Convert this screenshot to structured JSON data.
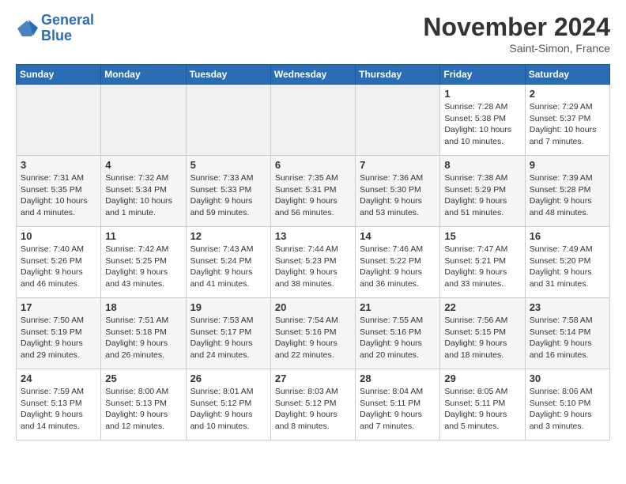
{
  "header": {
    "logo_line1": "General",
    "logo_line2": "Blue",
    "month_title": "November 2024",
    "location": "Saint-Simon, France"
  },
  "weekdays": [
    "Sunday",
    "Monday",
    "Tuesday",
    "Wednesday",
    "Thursday",
    "Friday",
    "Saturday"
  ],
  "weeks": [
    [
      {
        "day": "",
        "info": ""
      },
      {
        "day": "",
        "info": ""
      },
      {
        "day": "",
        "info": ""
      },
      {
        "day": "",
        "info": ""
      },
      {
        "day": "",
        "info": ""
      },
      {
        "day": "1",
        "info": "Sunrise: 7:28 AM\nSunset: 5:38 PM\nDaylight: 10 hours and 10 minutes."
      },
      {
        "day": "2",
        "info": "Sunrise: 7:29 AM\nSunset: 5:37 PM\nDaylight: 10 hours and 7 minutes."
      }
    ],
    [
      {
        "day": "3",
        "info": "Sunrise: 7:31 AM\nSunset: 5:35 PM\nDaylight: 10 hours and 4 minutes."
      },
      {
        "day": "4",
        "info": "Sunrise: 7:32 AM\nSunset: 5:34 PM\nDaylight: 10 hours and 1 minute."
      },
      {
        "day": "5",
        "info": "Sunrise: 7:33 AM\nSunset: 5:33 PM\nDaylight: 9 hours and 59 minutes."
      },
      {
        "day": "6",
        "info": "Sunrise: 7:35 AM\nSunset: 5:31 PM\nDaylight: 9 hours and 56 minutes."
      },
      {
        "day": "7",
        "info": "Sunrise: 7:36 AM\nSunset: 5:30 PM\nDaylight: 9 hours and 53 minutes."
      },
      {
        "day": "8",
        "info": "Sunrise: 7:38 AM\nSunset: 5:29 PM\nDaylight: 9 hours and 51 minutes."
      },
      {
        "day": "9",
        "info": "Sunrise: 7:39 AM\nSunset: 5:28 PM\nDaylight: 9 hours and 48 minutes."
      }
    ],
    [
      {
        "day": "10",
        "info": "Sunrise: 7:40 AM\nSunset: 5:26 PM\nDaylight: 9 hours and 46 minutes."
      },
      {
        "day": "11",
        "info": "Sunrise: 7:42 AM\nSunset: 5:25 PM\nDaylight: 9 hours and 43 minutes."
      },
      {
        "day": "12",
        "info": "Sunrise: 7:43 AM\nSunset: 5:24 PM\nDaylight: 9 hours and 41 minutes."
      },
      {
        "day": "13",
        "info": "Sunrise: 7:44 AM\nSunset: 5:23 PM\nDaylight: 9 hours and 38 minutes."
      },
      {
        "day": "14",
        "info": "Sunrise: 7:46 AM\nSunset: 5:22 PM\nDaylight: 9 hours and 36 minutes."
      },
      {
        "day": "15",
        "info": "Sunrise: 7:47 AM\nSunset: 5:21 PM\nDaylight: 9 hours and 33 minutes."
      },
      {
        "day": "16",
        "info": "Sunrise: 7:49 AM\nSunset: 5:20 PM\nDaylight: 9 hours and 31 minutes."
      }
    ],
    [
      {
        "day": "17",
        "info": "Sunrise: 7:50 AM\nSunset: 5:19 PM\nDaylight: 9 hours and 29 minutes."
      },
      {
        "day": "18",
        "info": "Sunrise: 7:51 AM\nSunset: 5:18 PM\nDaylight: 9 hours and 26 minutes."
      },
      {
        "day": "19",
        "info": "Sunrise: 7:53 AM\nSunset: 5:17 PM\nDaylight: 9 hours and 24 minutes."
      },
      {
        "day": "20",
        "info": "Sunrise: 7:54 AM\nSunset: 5:16 PM\nDaylight: 9 hours and 22 minutes."
      },
      {
        "day": "21",
        "info": "Sunrise: 7:55 AM\nSunset: 5:16 PM\nDaylight: 9 hours and 20 minutes."
      },
      {
        "day": "22",
        "info": "Sunrise: 7:56 AM\nSunset: 5:15 PM\nDaylight: 9 hours and 18 minutes."
      },
      {
        "day": "23",
        "info": "Sunrise: 7:58 AM\nSunset: 5:14 PM\nDaylight: 9 hours and 16 minutes."
      }
    ],
    [
      {
        "day": "24",
        "info": "Sunrise: 7:59 AM\nSunset: 5:13 PM\nDaylight: 9 hours and 14 minutes."
      },
      {
        "day": "25",
        "info": "Sunrise: 8:00 AM\nSunset: 5:13 PM\nDaylight: 9 hours and 12 minutes."
      },
      {
        "day": "26",
        "info": "Sunrise: 8:01 AM\nSunset: 5:12 PM\nDaylight: 9 hours and 10 minutes."
      },
      {
        "day": "27",
        "info": "Sunrise: 8:03 AM\nSunset: 5:12 PM\nDaylight: 9 hours and 8 minutes."
      },
      {
        "day": "28",
        "info": "Sunrise: 8:04 AM\nSunset: 5:11 PM\nDaylight: 9 hours and 7 minutes."
      },
      {
        "day": "29",
        "info": "Sunrise: 8:05 AM\nSunset: 5:11 PM\nDaylight: 9 hours and 5 minutes."
      },
      {
        "day": "30",
        "info": "Sunrise: 8:06 AM\nSunset: 5:10 PM\nDaylight: 9 hours and 3 minutes."
      }
    ]
  ]
}
